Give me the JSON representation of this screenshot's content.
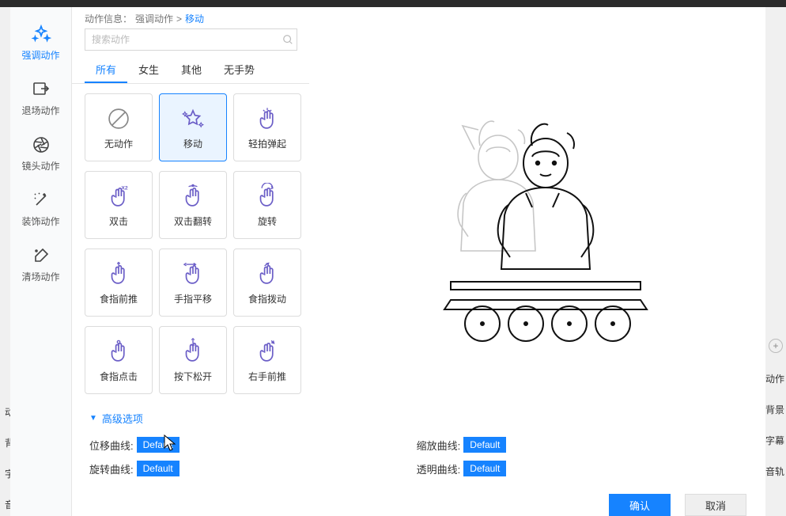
{
  "breadcrumb": {
    "prefix": "动作信息：",
    "parent": "强调动作",
    "sep": ">",
    "current": "移动"
  },
  "search": {
    "placeholder": "搜索动作"
  },
  "sidebar": [
    {
      "label": "强调动作",
      "icon": "sparkle",
      "active": true
    },
    {
      "label": "退场动作",
      "icon": "exit",
      "active": false
    },
    {
      "label": "镜头动作",
      "icon": "aperture",
      "active": false
    },
    {
      "label": "装饰动作",
      "icon": "wand",
      "active": false
    },
    {
      "label": "清场动作",
      "icon": "brush",
      "active": false
    }
  ],
  "tabs": [
    {
      "label": "所有",
      "active": true
    },
    {
      "label": "女生",
      "active": false
    },
    {
      "label": "其他",
      "active": false
    },
    {
      "label": "无手势",
      "active": false
    }
  ],
  "actions": [
    {
      "label": "无动作",
      "icon": "none",
      "selected": false
    },
    {
      "label": "移动",
      "icon": "star-sparkle",
      "selected": true
    },
    {
      "label": "轻拍弹起",
      "icon": "hand-tap",
      "selected": false
    },
    {
      "label": "双击",
      "icon": "hand-x2",
      "selected": false
    },
    {
      "label": "双击翻转",
      "icon": "hand-double",
      "selected": false
    },
    {
      "label": "旋转",
      "icon": "hand-rotate",
      "selected": false
    },
    {
      "label": "食指前推",
      "icon": "finger-push",
      "selected": false
    },
    {
      "label": "手指平移",
      "icon": "finger-move",
      "selected": false
    },
    {
      "label": "食指拨动",
      "icon": "finger-flick",
      "selected": false
    },
    {
      "label": "食指点击",
      "icon": "finger-click",
      "selected": false
    },
    {
      "label": "按下松开",
      "icon": "press-release",
      "selected": false
    },
    {
      "label": "右手前推",
      "icon": "hand-push",
      "selected": false
    }
  ],
  "advanced": {
    "title": "高级选项",
    "curves": {
      "position": {
        "label": "位移曲线:",
        "value": "Default"
      },
      "rotation": {
        "label": "旋转曲线:",
        "value": "Default"
      },
      "scale": {
        "label": "缩放曲线:",
        "value": "Default"
      },
      "opacity": {
        "label": "透明曲线:",
        "value": "Default"
      }
    }
  },
  "buttons": {
    "ok": "确认",
    "cancel": "取消"
  },
  "bg_right": [
    "动作",
    "背景",
    "字幕",
    "音轨"
  ],
  "bg_left": [
    "动",
    "背",
    "字",
    "音"
  ]
}
